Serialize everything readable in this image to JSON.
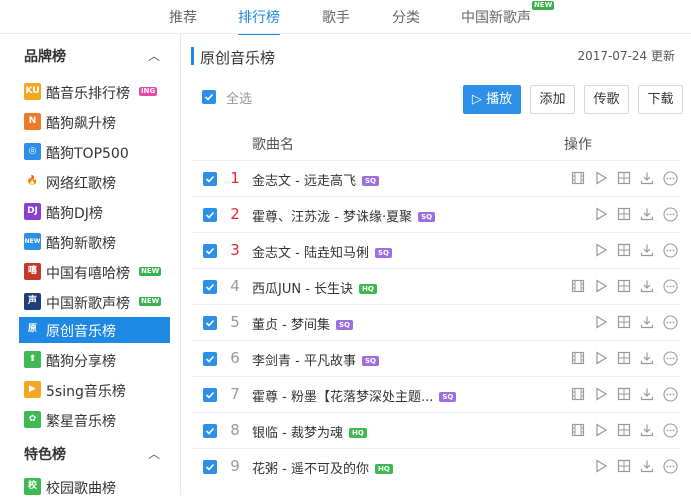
{
  "topnav": {
    "tabs": [
      {
        "label": "推荐"
      },
      {
        "label": "排行榜"
      },
      {
        "label": "歌手"
      },
      {
        "label": "分类"
      },
      {
        "label": "中国新歌声"
      }
    ],
    "active_tab": "排行榜",
    "new_badge": "NEW"
  },
  "sidebar": {
    "groups": [
      {
        "title": "品牌榜"
      },
      {
        "title": "特色榜"
      }
    ],
    "items": [
      {
        "label": "酷音乐排行榜",
        "icon": "ku-icon",
        "icon_text": "KU",
        "icon_color": "#f5a623",
        "badge": "ING",
        "badge_color": "#e64aa8"
      },
      {
        "label": "酷狗飙升榜",
        "icon": "n-icon",
        "icon_text": "N",
        "icon_color": "#f07a2b"
      },
      {
        "label": "酷狗TOP500",
        "icon": "kugou-icon",
        "icon_text": "◎",
        "icon_color": "#2d8fe8"
      },
      {
        "label": "网络红歌榜",
        "icon": "flame-icon",
        "icon_text": "🔥",
        "icon_color": "#ffffff"
      },
      {
        "label": "酷狗DJ榜",
        "icon": "dj-icon",
        "icon_text": "DJ",
        "icon_color": "#8a3fd1"
      },
      {
        "label": "酷狗新歌榜",
        "icon": "new-icon",
        "icon_text": "NEW",
        "icon_color": "#2d8fe8"
      },
      {
        "label": "中国有嘻哈榜",
        "icon": "hiphop-icon",
        "icon_text": "嘻",
        "icon_color": "#c0392b",
        "badge": "NEW",
        "badge_color": "#36b34a"
      },
      {
        "label": "中国新歌声榜",
        "icon": "voice-icon",
        "icon_text": "声",
        "icon_color": "#1f3f7a",
        "badge": "NEW",
        "badge_color": "#36b34a"
      },
      {
        "label": "原创音乐榜",
        "icon": "original-icon",
        "icon_text": "原",
        "icon_color": "#1e88e5"
      },
      {
        "label": "酷狗分享榜",
        "icon": "share-icon",
        "icon_text": "⬆",
        "icon_color": "#3fba52"
      },
      {
        "label": "5sing音乐榜",
        "icon": "5sing-icon",
        "icon_text": "▶",
        "icon_color": "#f5a623"
      },
      {
        "label": "繁星音乐榜",
        "icon": "star-icon",
        "icon_text": "✿",
        "icon_color": "#3fba52"
      },
      {
        "label": "校园歌曲榜",
        "icon": "campus-icon",
        "icon_text": "校",
        "icon_color": "#3fba52"
      }
    ],
    "active_item": "原创音乐榜"
  },
  "main": {
    "title": "原创音乐榜",
    "updated": "2017-07-24 更新",
    "select_all": "全选",
    "buttons": {
      "play": "播放",
      "add": "添加",
      "upload": "传歌",
      "download": "下载"
    },
    "columns": {
      "song": "歌曲名",
      "ops": "操作"
    },
    "songs": [
      {
        "rank": "1",
        "title": "金志文 - 远走高飞",
        "quality": "SQ",
        "mv": true
      },
      {
        "rank": "2",
        "title": "霍尊、汪苏泷 - 梦诛缘·夏聚",
        "quality": "SQ",
        "mv": false
      },
      {
        "rank": "3",
        "title": "金志文 - 陆垚知马俐",
        "quality": "SQ",
        "mv": false
      },
      {
        "rank": "4",
        "title": "西瓜JUN - 长生诀",
        "quality": "HQ",
        "mv": true
      },
      {
        "rank": "5",
        "title": "董贞 - 梦间集",
        "quality": "SQ",
        "mv": false
      },
      {
        "rank": "6",
        "title": "李剑青 - 平凡故事",
        "quality": "SQ",
        "mv": true
      },
      {
        "rank": "7",
        "title": "霍尊 - 粉墨【花落梦深处主题...",
        "quality": "SQ",
        "mv": true
      },
      {
        "rank": "8",
        "title": "银临 - 裁梦为魂",
        "quality": "HQ",
        "mv": true
      },
      {
        "rank": "9",
        "title": "花粥 - 遥不可及的你",
        "quality": "HQ",
        "mv": false
      }
    ]
  }
}
